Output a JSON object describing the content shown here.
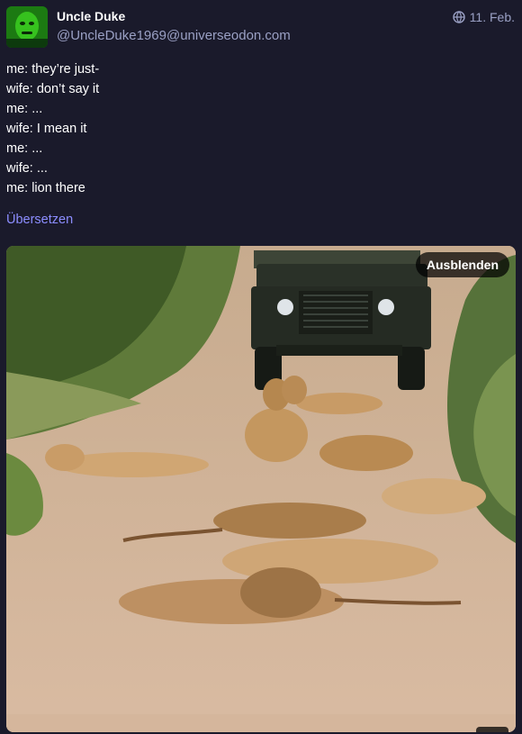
{
  "author": {
    "display_name": "Uncle Duke",
    "handle": "@UncleDuke1969@universeodon.com"
  },
  "post": {
    "visibility_icon": "globe-icon",
    "date": "11. Feb.",
    "lines": [
      "me: they’re just-",
      "wife: don’t say it",
      "me: ...",
      "wife: I mean it",
      "me: ...",
      "wife: ...",
      "me: lion there"
    ],
    "translate_label": "Übersetzen"
  },
  "media": {
    "hide_label": "Ausblenden"
  },
  "colors": {
    "background": "#1a1a2b",
    "link": "#8c8dff",
    "secondary_text": "#9aa0c4"
  }
}
